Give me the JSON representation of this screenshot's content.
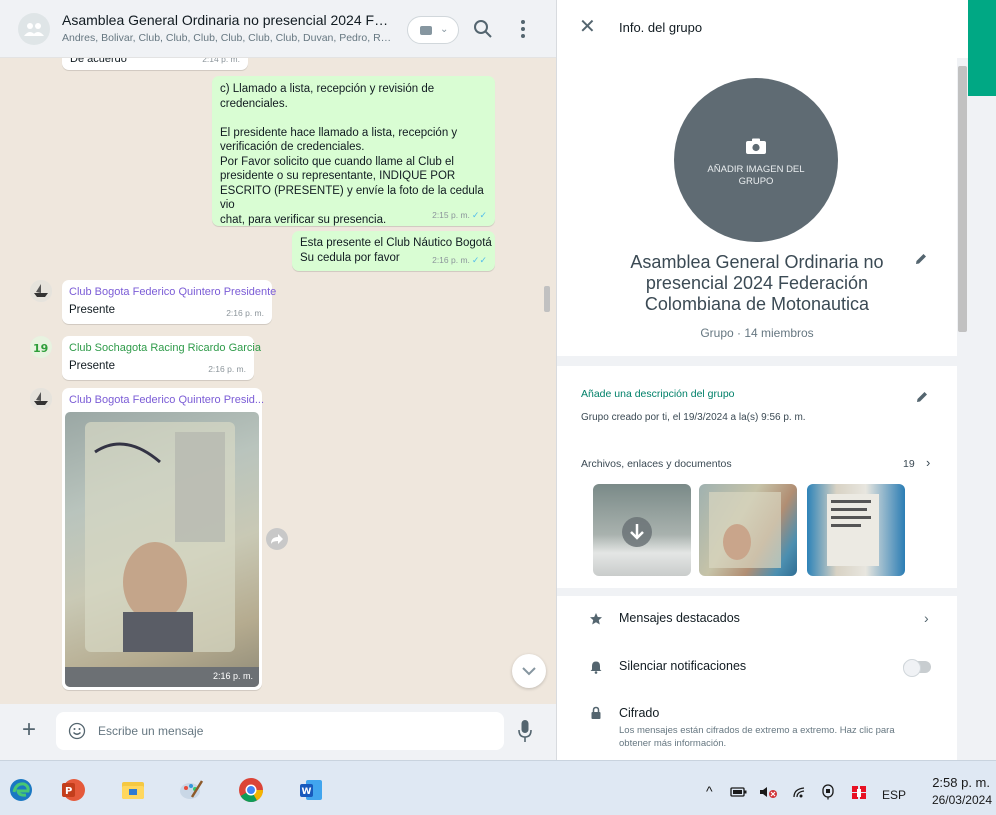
{
  "chat": {
    "title": "Asamblea General Ordinaria no presencial 2024 Feder...",
    "members": "Andres, Bolivar, Club, Club, Club, Club, Club, Club, Duvan, Pedro, Re...",
    "messages": {
      "top_fragment": "De acuerdo",
      "top_fragment_time": "2:14 p. m.",
      "m1_lines": [
        "c)    Llamado a lista, recepción y revisión de",
        "credenciales.",
        "",
        "El presidente hace llamado a lista, recepción y",
        "verificación de credenciales.",
        "Por Favor solicito que cuando llame al Club el",
        "presidente o su representante, INDIQUE POR",
        "ESCRITO (PRESENTE) y envíe la foto de la cedula vio",
        "chat, para verificar su presencia."
      ],
      "m1_time": "2:15 p. m.",
      "m2_lines": [
        "Esta presente el Club Náutico Bogotá",
        "Su cedula por favor"
      ],
      "m2_time": "2:16 p. m.",
      "m3_sender": "Club Bogota Federico Quintero Presidente",
      "m3_text": "Presente",
      "m3_time": "2:16 p. m.",
      "m4_sender": "Club Sochagota Racing Ricardo Garcia",
      "m4_text": "Presente",
      "m4_time": "2:16 p. m.",
      "m5_sender": "Club Bogota Federico Quintero Presid...",
      "m5_time": "2:16 p. m."
    },
    "composer_placeholder": "Escribe un mensaje",
    "attach_label": "+"
  },
  "info": {
    "close_label": "✕",
    "title": "Info. del grupo",
    "photo_label": "AÑADIR IMAGEN DEL GRUPO",
    "group_name": "Asamblea General Ordinaria no presencial 2024 Federación Colombiana de Motonautica",
    "group_meta": "Grupo · 14 miembros",
    "desc_add": "Añade una descripción del grupo",
    "desc_created": "Grupo creado por ti, el 19/3/2024 a la(s) 9:56 p. m.",
    "media_label": "Archivos, enlaces y documentos",
    "media_count": "19",
    "opt_starred": "Mensajes destacados",
    "opt_mute": "Silenciar notificaciones",
    "opt_encryption": "Cifrado",
    "opt_encryption_desc": "Los mensajes están cifrados de extremo a extremo. Haz clic para obtener más información."
  },
  "taskbar": {
    "lang": "ESP",
    "time": "2:58 p. m.",
    "date": "26/03/2024"
  },
  "colors": {
    "accent": "#00a884",
    "outgoing_bubble": "#d9fdd3",
    "sender_name": "#7b5cd6",
    "link_green": "#008069"
  }
}
